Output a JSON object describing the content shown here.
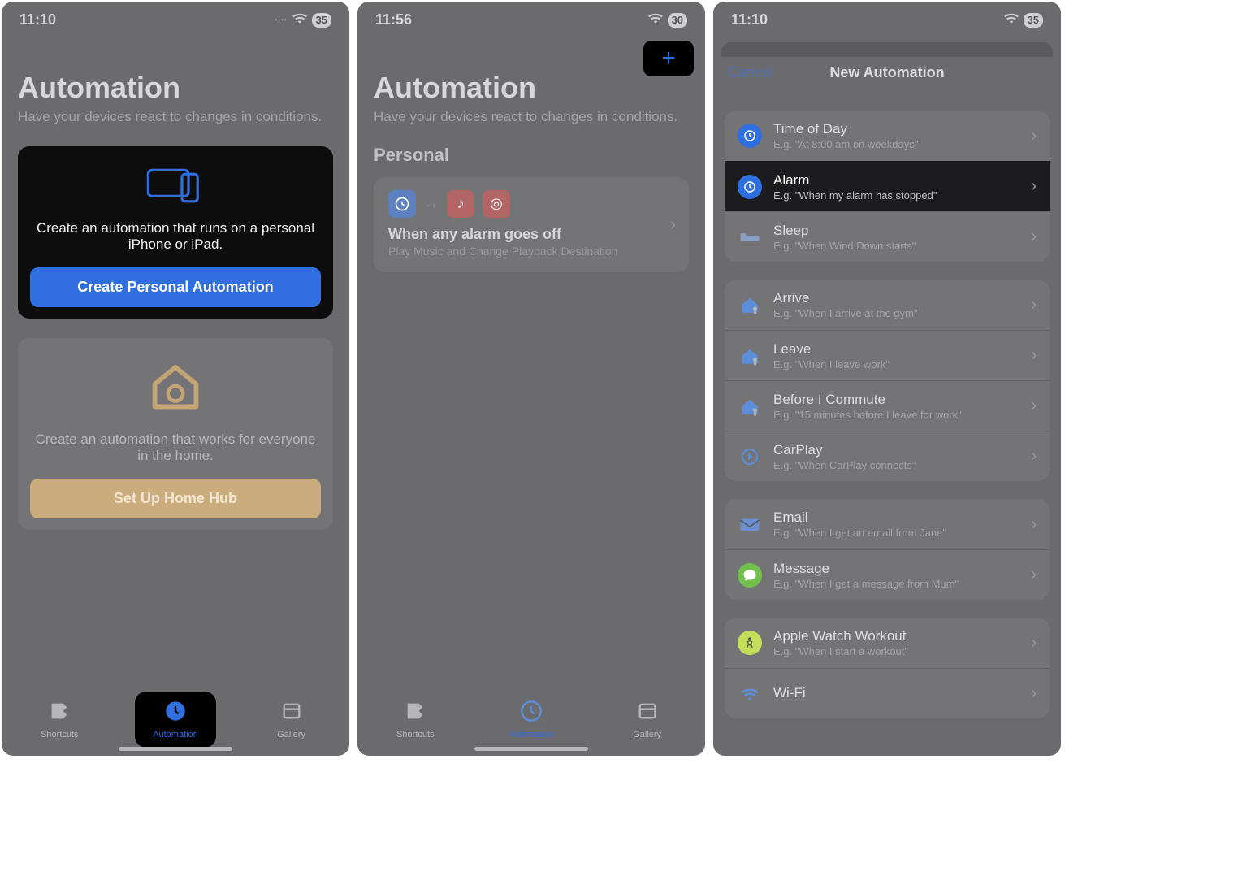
{
  "status": {
    "p1_time": "11:10",
    "p2_time": "11:56",
    "p3_time": "11:10",
    "p1_battery": "35",
    "p2_battery": "30",
    "p3_battery": "35"
  },
  "automation_title": "Automation",
  "automation_subtitle": "Have your devices react to changes in conditions.",
  "personal_card": {
    "desc": "Create an automation that runs on a personal iPhone or iPad.",
    "cta": "Create Personal Automation"
  },
  "home_card": {
    "desc": "Create an automation that works for everyone in the home.",
    "cta": "Set Up Home Hub"
  },
  "tabs": {
    "shortcuts": "Shortcuts",
    "automation": "Automation",
    "gallery": "Gallery"
  },
  "panel2": {
    "section": "Personal",
    "row_title": "When any alarm goes off",
    "row_sub": "Play Music and Change Playback Destination"
  },
  "panel3": {
    "cancel": "Cancel",
    "title": "New Automation",
    "triggers_a": [
      {
        "icon": "clock",
        "title": "Time of Day",
        "sub": "E.g. \"At 8:00 am on weekdays\""
      },
      {
        "icon": "alarm",
        "title": "Alarm",
        "sub": "E.g. \"When my alarm has stopped\"",
        "active": true
      },
      {
        "icon": "bed",
        "title": "Sleep",
        "sub": "E.g. \"When Wind Down starts\""
      }
    ],
    "triggers_b": [
      {
        "icon": "home",
        "title": "Arrive",
        "sub": "E.g. \"When I arrive at the gym\""
      },
      {
        "icon": "home",
        "title": "Leave",
        "sub": "E.g. \"When I leave work\""
      },
      {
        "icon": "home",
        "title": "Before I Commute",
        "sub": "E.g. \"15 minutes before I leave for work\""
      },
      {
        "icon": "carplay",
        "title": "CarPlay",
        "sub": "E.g. \"When CarPlay connects\""
      }
    ],
    "triggers_c": [
      {
        "icon": "mail",
        "title": "Email",
        "sub": "E.g. \"When I get an email from Jane\""
      },
      {
        "icon": "message",
        "title": "Message",
        "sub": "E.g. \"When I get a message from Mum\""
      }
    ],
    "triggers_d": [
      {
        "icon": "workout",
        "title": "Apple Watch Workout",
        "sub": "E.g. \"When I start a workout\""
      },
      {
        "icon": "wifi",
        "title": "Wi-Fi",
        "sub": ""
      }
    ]
  }
}
